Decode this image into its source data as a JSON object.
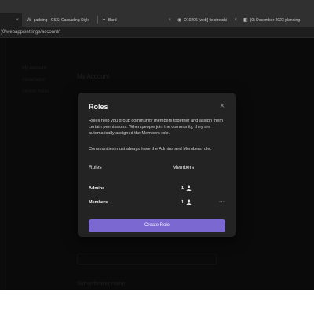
{
  "browser": {
    "tabs": [
      {
        "favicon": "×",
        "label": "",
        "active": true
      },
      {
        "favicon": "W",
        "label": "padding - CSS: Cascading Style",
        "active": false
      },
      {
        "favicon": "✦",
        "label": "Bard",
        "active": false
      },
      {
        "favicon": "◉",
        "label": "D10206 [web] fix stretchi",
        "active": false
      },
      {
        "favicon": "◧",
        "label": "(0) December 2023 planning",
        "active": false
      }
    ],
    "url": ")0/webapp/settings/account/"
  },
  "settings": {
    "nav": [
      "My Account",
      "Moderation",
      "Server Roles"
    ],
    "heading": "My Account",
    "section": "Sunverbroker name"
  },
  "modal": {
    "title": "Roles",
    "description": "Roles help you group community members together and assign them certain permissions. When people join the community, they are automatically assigned the Members role.",
    "note": "Communities must always have the Admins and Members role.",
    "columns": {
      "roles": "Roles",
      "members": "Members"
    },
    "roles": [
      {
        "name": "Admins",
        "count": "1",
        "has_menu": false
      },
      {
        "name": "Members",
        "count": "1",
        "has_menu": true
      }
    ],
    "menu_glyph": "···",
    "create_label": "Create Role",
    "accent": "#7b68d1"
  }
}
